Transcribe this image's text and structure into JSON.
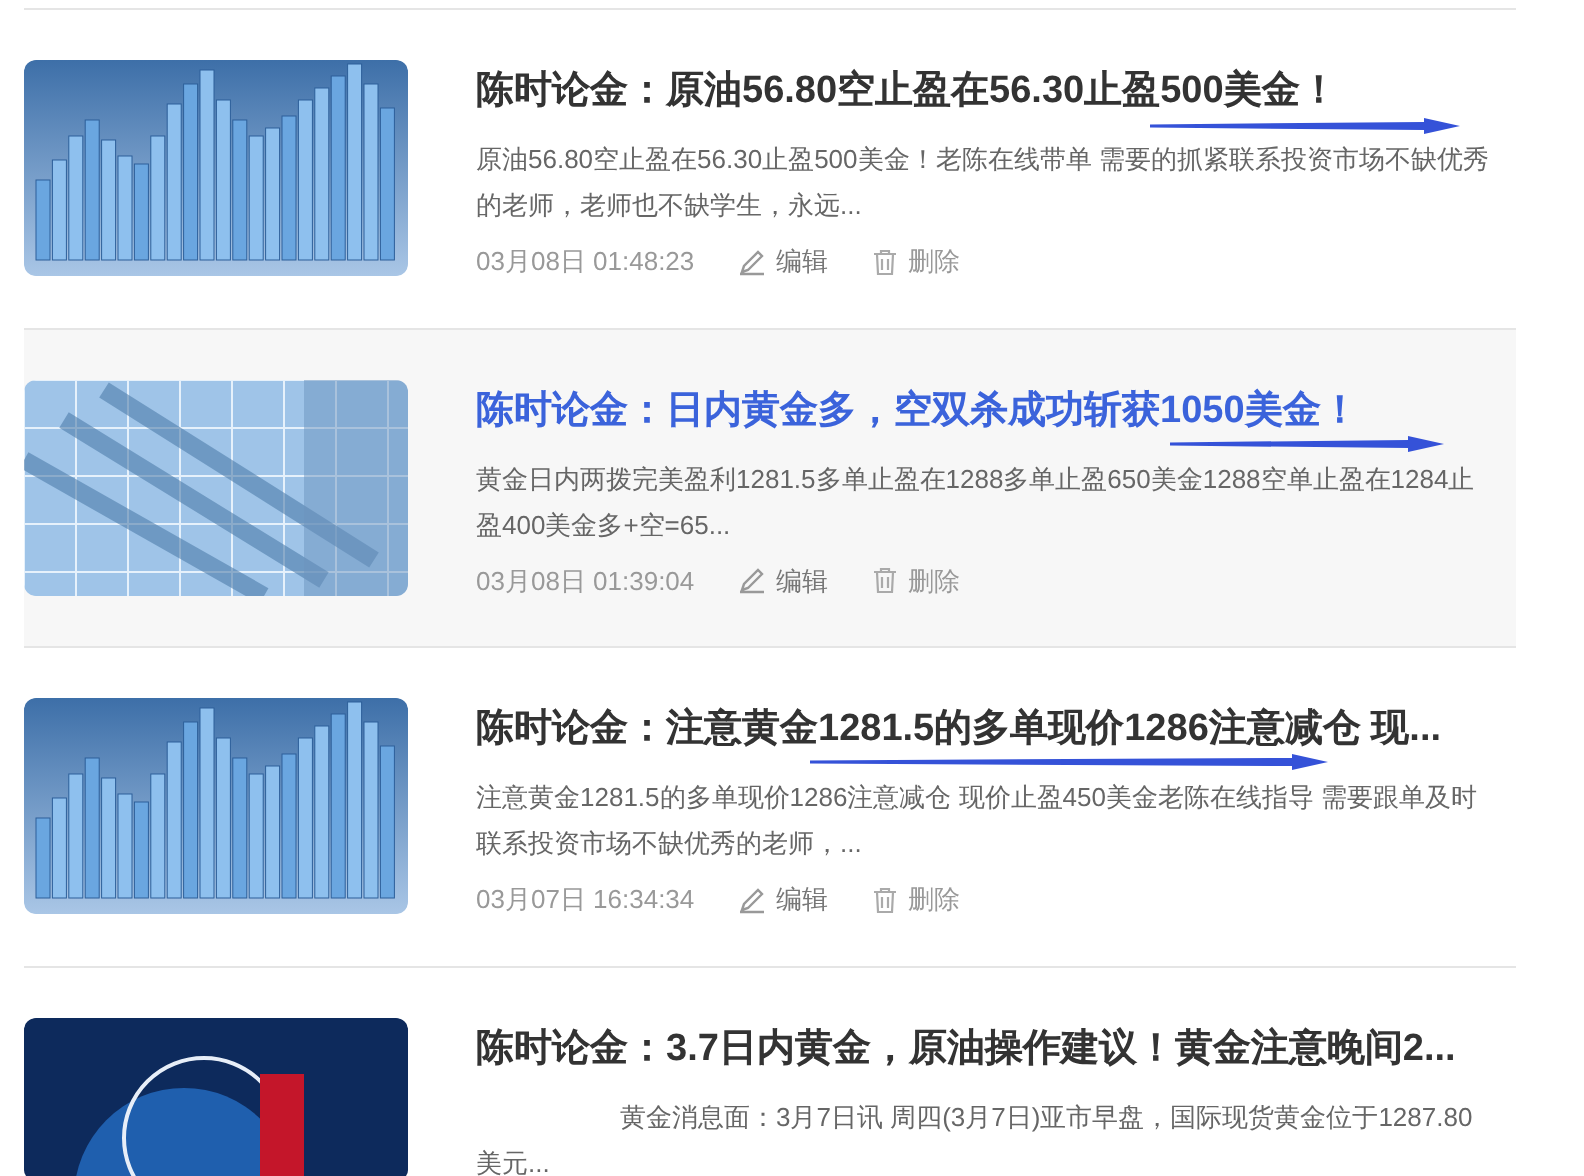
{
  "articles": [
    {
      "thumbnail": {
        "kind": "bars"
      },
      "title": "陈时论金：原油56.80空止盈在56.30止盈500美金！",
      "excerpt": "原油56.80空止盈在56.30止盈500美金！老陈在线带单 需要的抓紧联系投资市场不缺优秀的老师，老师也不缺学生，永远...",
      "indent": false,
      "date": "03月08日 01:48:23",
      "edit": "编辑",
      "delete": "删除",
      "selected": false
    },
    {
      "thumbnail": {
        "kind": "grid"
      },
      "title": "陈时论金：日内黄金多，空双杀成功斩获1050美金！",
      "excerpt": "黄金日内两拨完美盈利1281.5多单止盈在1288多单止盈650美金1288空单止盈在1284止盈400美金多+空=65...",
      "indent": false,
      "date": "03月08日 01:39:04",
      "edit": "编辑",
      "delete": "删除",
      "selected": true
    },
    {
      "thumbnail": {
        "kind": "bars"
      },
      "title": "陈时论金：注意黄金1281.5的多单现价1286注意减仓 现...",
      "excerpt": "注意黄金1281.5的多单现价1286注意减仓 现价止盈450美金老陈在线指导 需要跟单及时联系投资市场不缺优秀的老师，...",
      "indent": false,
      "date": "03月07日 16:34:34",
      "edit": "编辑",
      "delete": "删除",
      "selected": false
    },
    {
      "thumbnail": {
        "kind": "promo"
      },
      "title": "陈时论金：3.7日内黄金，原油操作建议！黄金注意晚间2...",
      "excerpt": "黄金消息面：3月7日讯 周四(3月7日)亚市早盘，国际现货黄金位于1287.80美元...",
      "indent": true,
      "selected": false
    }
  ]
}
